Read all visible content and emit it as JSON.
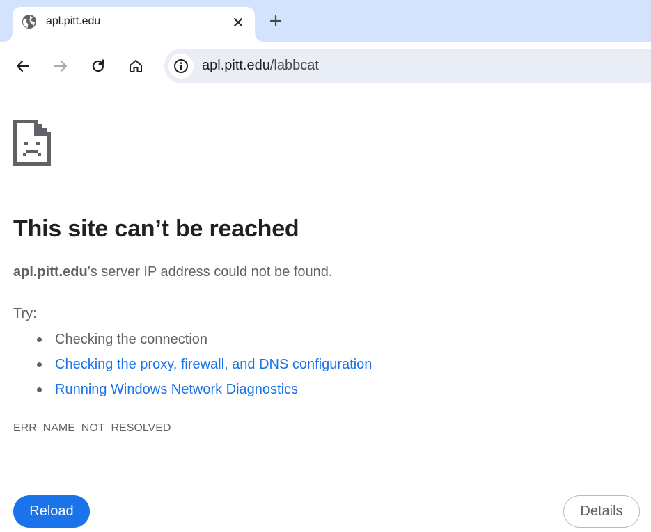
{
  "tab": {
    "title": "apl.pitt.edu",
    "favicon_icon": "globe-icon",
    "close_icon": "close-icon"
  },
  "toolbar": {
    "new_tab_icon": "plus-icon",
    "back_icon": "arrow-left-icon",
    "forward_icon": "arrow-right-icon",
    "reload_icon": "reload-icon",
    "home_icon": "home-icon",
    "site_info_icon": "info-icon",
    "url_host": "apl.pitt.edu",
    "url_path": "/labbcat"
  },
  "error": {
    "icon": "sad-page-icon",
    "heading": "This site can’t be reached",
    "host": "apl.pitt.edu",
    "message_rest": "’s server IP address could not be found.",
    "try_label": "Try:",
    "suggestions": [
      {
        "text": "Checking the connection",
        "link": false
      },
      {
        "text": "Checking the proxy, firewall, and DNS configuration",
        "link": true
      },
      {
        "text": "Running Windows Network Diagnostics",
        "link": true
      }
    ],
    "code": "ERR_NAME_NOT_RESOLVED",
    "reload_label": "Reload",
    "details_label": "Details"
  },
  "colors": {
    "tabstrip_bg": "#d3e3fd",
    "omnibox_bg": "#e9eef6",
    "link": "#1a73e8",
    "primary_button": "#1a73e8",
    "body_text": "#5f6368",
    "heading_text": "#202124"
  }
}
